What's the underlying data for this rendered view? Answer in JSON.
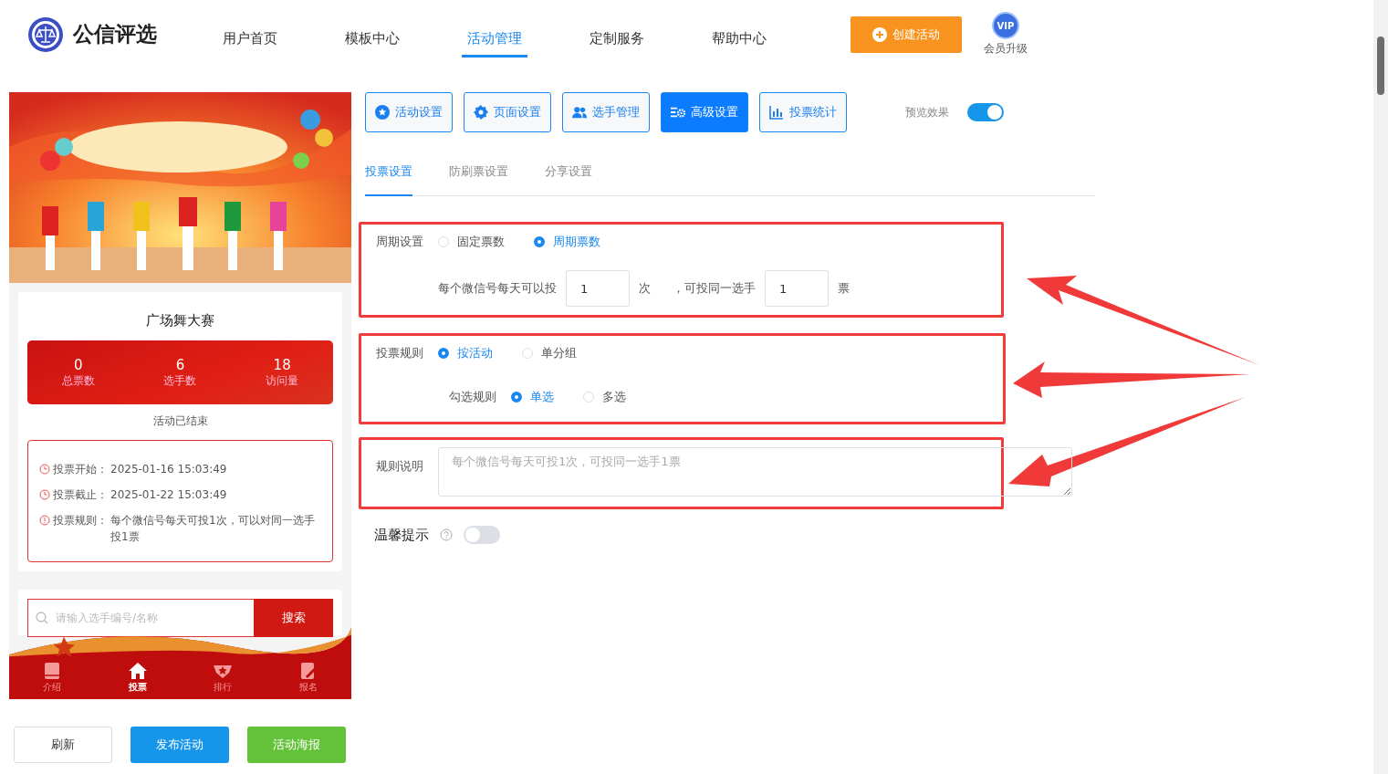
{
  "header": {
    "brand": "公信评选",
    "nav": [
      {
        "label": "用户首页",
        "selected": false
      },
      {
        "label": "模板中心",
        "selected": false
      },
      {
        "label": "活动管理",
        "selected": true
      },
      {
        "label": "定制服务",
        "selected": false
      },
      {
        "label": "帮助中心",
        "selected": false
      }
    ],
    "create_button": "创建活动",
    "vip_badge": "VIP",
    "vip_label": "会员升级"
  },
  "preview": {
    "title": "广场舞大赛",
    "stats": [
      {
        "value": "0",
        "label": "总票数"
      },
      {
        "value": "6",
        "label": "选手数"
      },
      {
        "value": "18",
        "label": "访问量"
      }
    ],
    "status": "活动已结束",
    "info": [
      {
        "kind": "clock",
        "label": "投票开始：",
        "value": "2025-01-16 15:03:49"
      },
      {
        "kind": "clock",
        "label": "投票截止：",
        "value": "2025-01-22 15:03:49"
      },
      {
        "kind": "alert",
        "label": "投票规则：",
        "value": "每个微信号每天可投1次，可以对同一选手投1票"
      }
    ],
    "search": {
      "placeholder": "请输入选手编号/名称",
      "button": "搜索"
    },
    "tabbar": [
      {
        "kind": "book",
        "label": "介绍",
        "selected": false
      },
      {
        "kind": "home",
        "label": "投票",
        "selected": true
      },
      {
        "kind": "badge",
        "label": "排行",
        "selected": false
      },
      {
        "kind": "edit",
        "label": "报名",
        "selected": false
      }
    ]
  },
  "actions": [
    {
      "kind": "default",
      "label": "刷新"
    },
    {
      "kind": "primary",
      "label": "发布活动"
    },
    {
      "kind": "success",
      "label": "活动海报"
    }
  ],
  "toolbar": {
    "buttons": [
      {
        "kind": "star",
        "label": "活动设置",
        "selected": false
      },
      {
        "kind": "gear",
        "label": "页面设置",
        "selected": false
      },
      {
        "kind": "users",
        "label": "选手管理",
        "selected": false
      },
      {
        "kind": "sliders",
        "label": "高级设置",
        "selected": true
      },
      {
        "kind": "chart",
        "label": "投票统计",
        "selected": false
      }
    ],
    "preview_label": "预览效果",
    "preview_on": true
  },
  "tabs": [
    {
      "label": "投票设置",
      "selected": true
    },
    {
      "label": "防刷票设置",
      "selected": false
    },
    {
      "label": "分享设置",
      "selected": false
    }
  ],
  "period": {
    "label": "周期设置",
    "options": [
      {
        "label": "固定票数",
        "selected": false
      },
      {
        "label": "周期票数",
        "selected": true
      }
    ],
    "prefix": "每个微信号每天可以投",
    "times": "1",
    "times_unit": "次",
    "middle": "，可投同一选手",
    "votes": "1",
    "votes_unit": "票"
  },
  "rule": {
    "label": "投票规则",
    "options": [
      {
        "label": "按活动",
        "selected": true
      },
      {
        "label": "单分组",
        "selected": false
      }
    ],
    "check_label": "勾选规则",
    "check_options": [
      {
        "label": "单选",
        "selected": true
      },
      {
        "label": "多选",
        "selected": false
      }
    ]
  },
  "description": {
    "label": "规则说明",
    "placeholder": "每个微信号每天可投1次，可投同一选手1票"
  },
  "tip": {
    "label": "温馨提示",
    "on": false
  }
}
